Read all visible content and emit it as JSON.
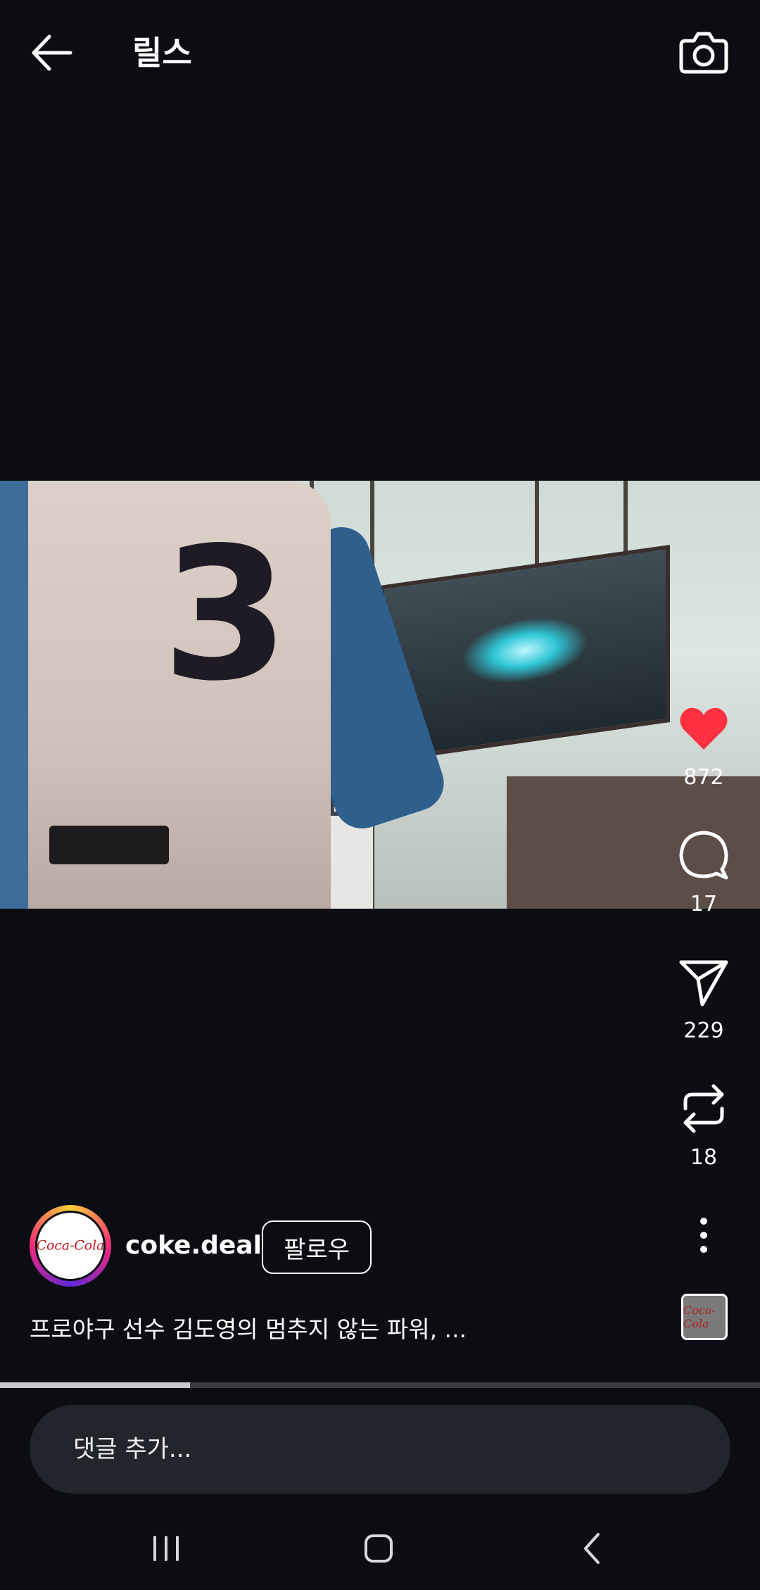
{
  "header": {
    "title": "릴스"
  },
  "actions": {
    "likes": "872",
    "comments": "17",
    "shares": "229",
    "remixes": "18"
  },
  "post": {
    "username": "coke.deal",
    "follow_label": "팔로우",
    "caption": "프로야구 선수 김도영의 멈추지 않는 파워, ...",
    "avatar_text": "Coca-Cola",
    "audio_thumb_text": "Coca-Cola"
  },
  "video": {
    "jersey_number": "3",
    "progress": 0.25
  },
  "comment": {
    "placeholder": "댓글 추가..."
  },
  "colors": {
    "like": "#ff3040",
    "background": "#0b0d12"
  },
  "icons": [
    "back-arrow-icon",
    "camera-icon",
    "heart-icon",
    "comment-icon",
    "send-icon",
    "remix-icon",
    "more-vertical-icon",
    "recent-apps-icon",
    "home-icon",
    "back-icon"
  ]
}
